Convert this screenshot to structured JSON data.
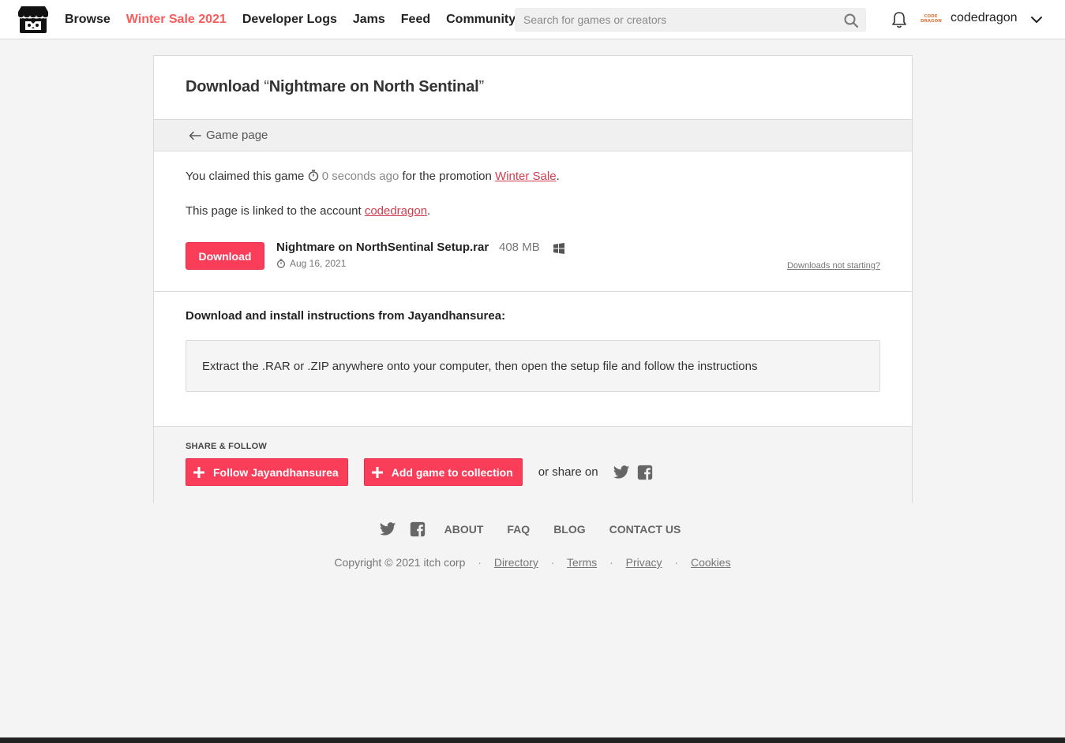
{
  "header": {
    "nav": [
      "Browse",
      "Winter Sale 2021",
      "Developer Logs",
      "Jams",
      "Feed",
      "Community"
    ],
    "search_placeholder": "Search for games or creators",
    "avatar_text": "CODE DRAGON",
    "username": "codedragon"
  },
  "page": {
    "title_prefix": "Download",
    "open_quote": "“",
    "game_title": "Nightmare on North Sentinal",
    "close_quote": "”",
    "back_label": "Game page",
    "claim_prefix": "You claimed this game",
    "claim_time": "0 seconds ago",
    "claim_middle": "for the promotion",
    "promotion_link": "Winter Sale",
    "claim_suffix": ".",
    "linked_prefix": "This page is linked to the account",
    "linked_account": "codedragon",
    "linked_suffix": ".",
    "download_button": "Download",
    "file_name": "Nightmare on NorthSentinal Setup.rar",
    "file_size": "408 MB",
    "file_date": "Aug 16, 2021",
    "not_starting": "Downloads not starting?",
    "instructions_title": "Download and install instructions from Jayandhansurea:",
    "instructions_text": "Extract the .RAR or .ZIP anywhere onto your computer, then open the setup file and follow the instructions"
  },
  "share": {
    "title": "Share & Follow",
    "follow_button": "Follow Jayandhansurea",
    "collection_button": "Add game to collection",
    "share_text": "or share on"
  },
  "footer": {
    "links": [
      "About",
      "FAQ",
      "Blog",
      "Contact us"
    ],
    "copyright": "Copyright © 2021 itch corp",
    "legal": [
      "Directory",
      "Terms",
      "Privacy",
      "Cookies"
    ]
  },
  "colors": {
    "accent": "#fa3d59",
    "sale_nav": "#fa5c5c",
    "link": "#d13d4e"
  },
  "icons": [
    "itch-logo-icon",
    "search-icon",
    "bell-icon",
    "chevron-down-icon",
    "arrow-left-icon",
    "stopwatch-icon",
    "windows-icon",
    "plus-icon",
    "twitter-icon",
    "facebook-icon"
  ]
}
